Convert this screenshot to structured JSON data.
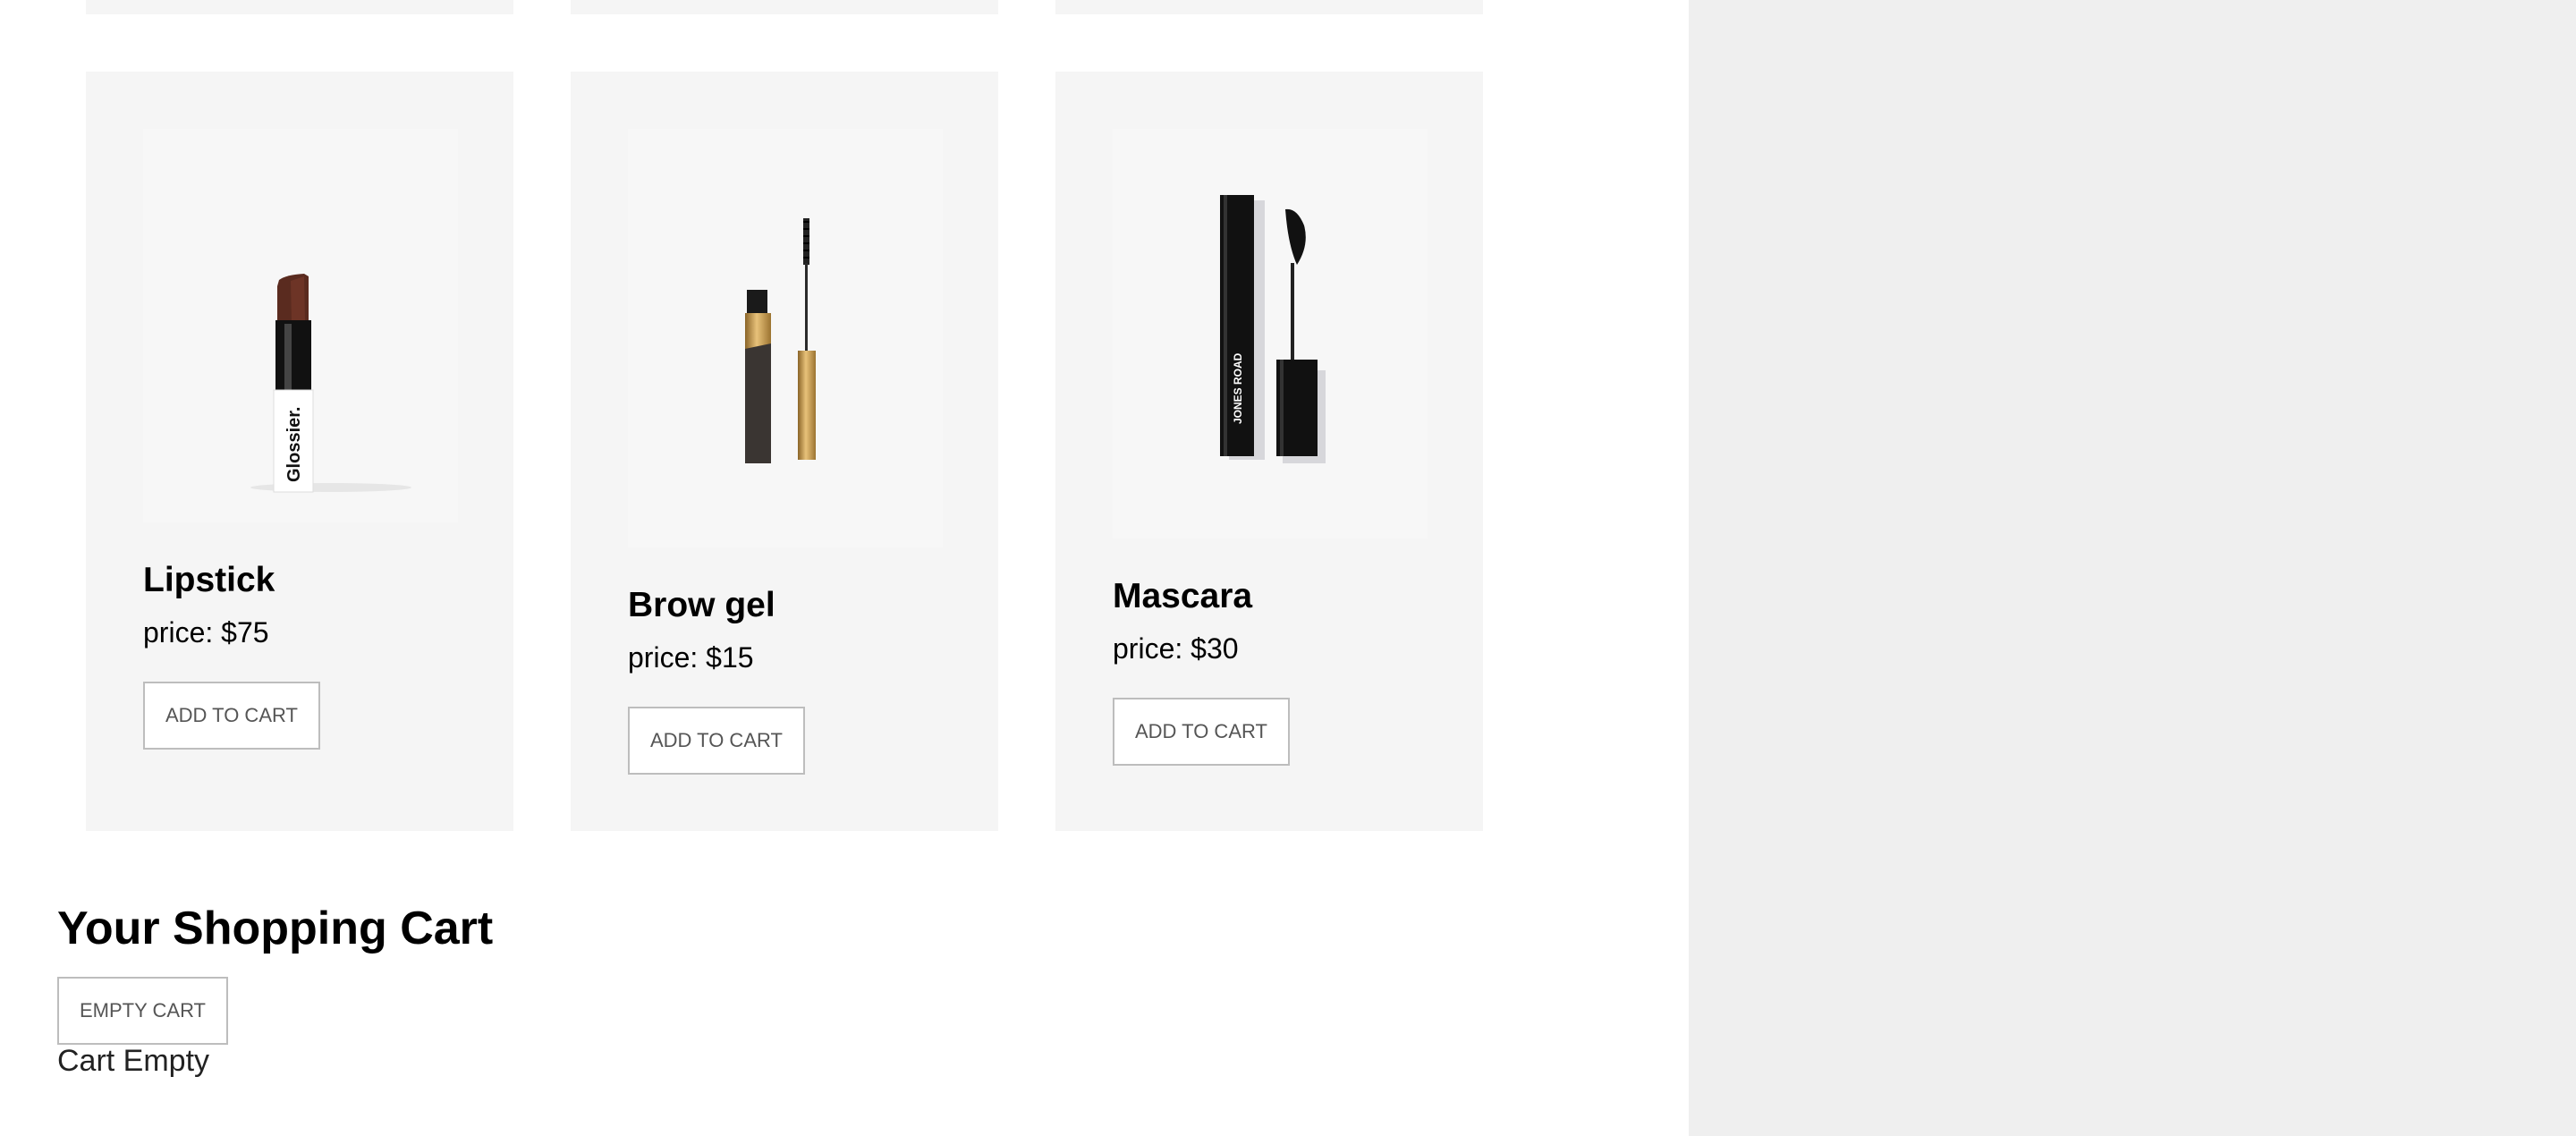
{
  "products": [
    {
      "name": "Lipstick",
      "price_text": "price: $75",
      "button_label": "ADD TO CART",
      "brand_text": "Glossier."
    },
    {
      "name": "Brow gel",
      "price_text": "price: $15",
      "button_label": "ADD TO CART",
      "brand_text": ""
    },
    {
      "name": "Mascara",
      "price_text": "price: $30",
      "button_label": "ADD TO CART",
      "brand_text": "JONES ROAD"
    }
  ],
  "cart": {
    "title": "Your Shopping Cart",
    "empty_button_label": "EMPTY CART",
    "status_text": "Cart Empty"
  },
  "colors": {
    "card_background": "#f5f5f5",
    "side_panel_background": "#efefef",
    "button_border": "#bdbdbd"
  }
}
